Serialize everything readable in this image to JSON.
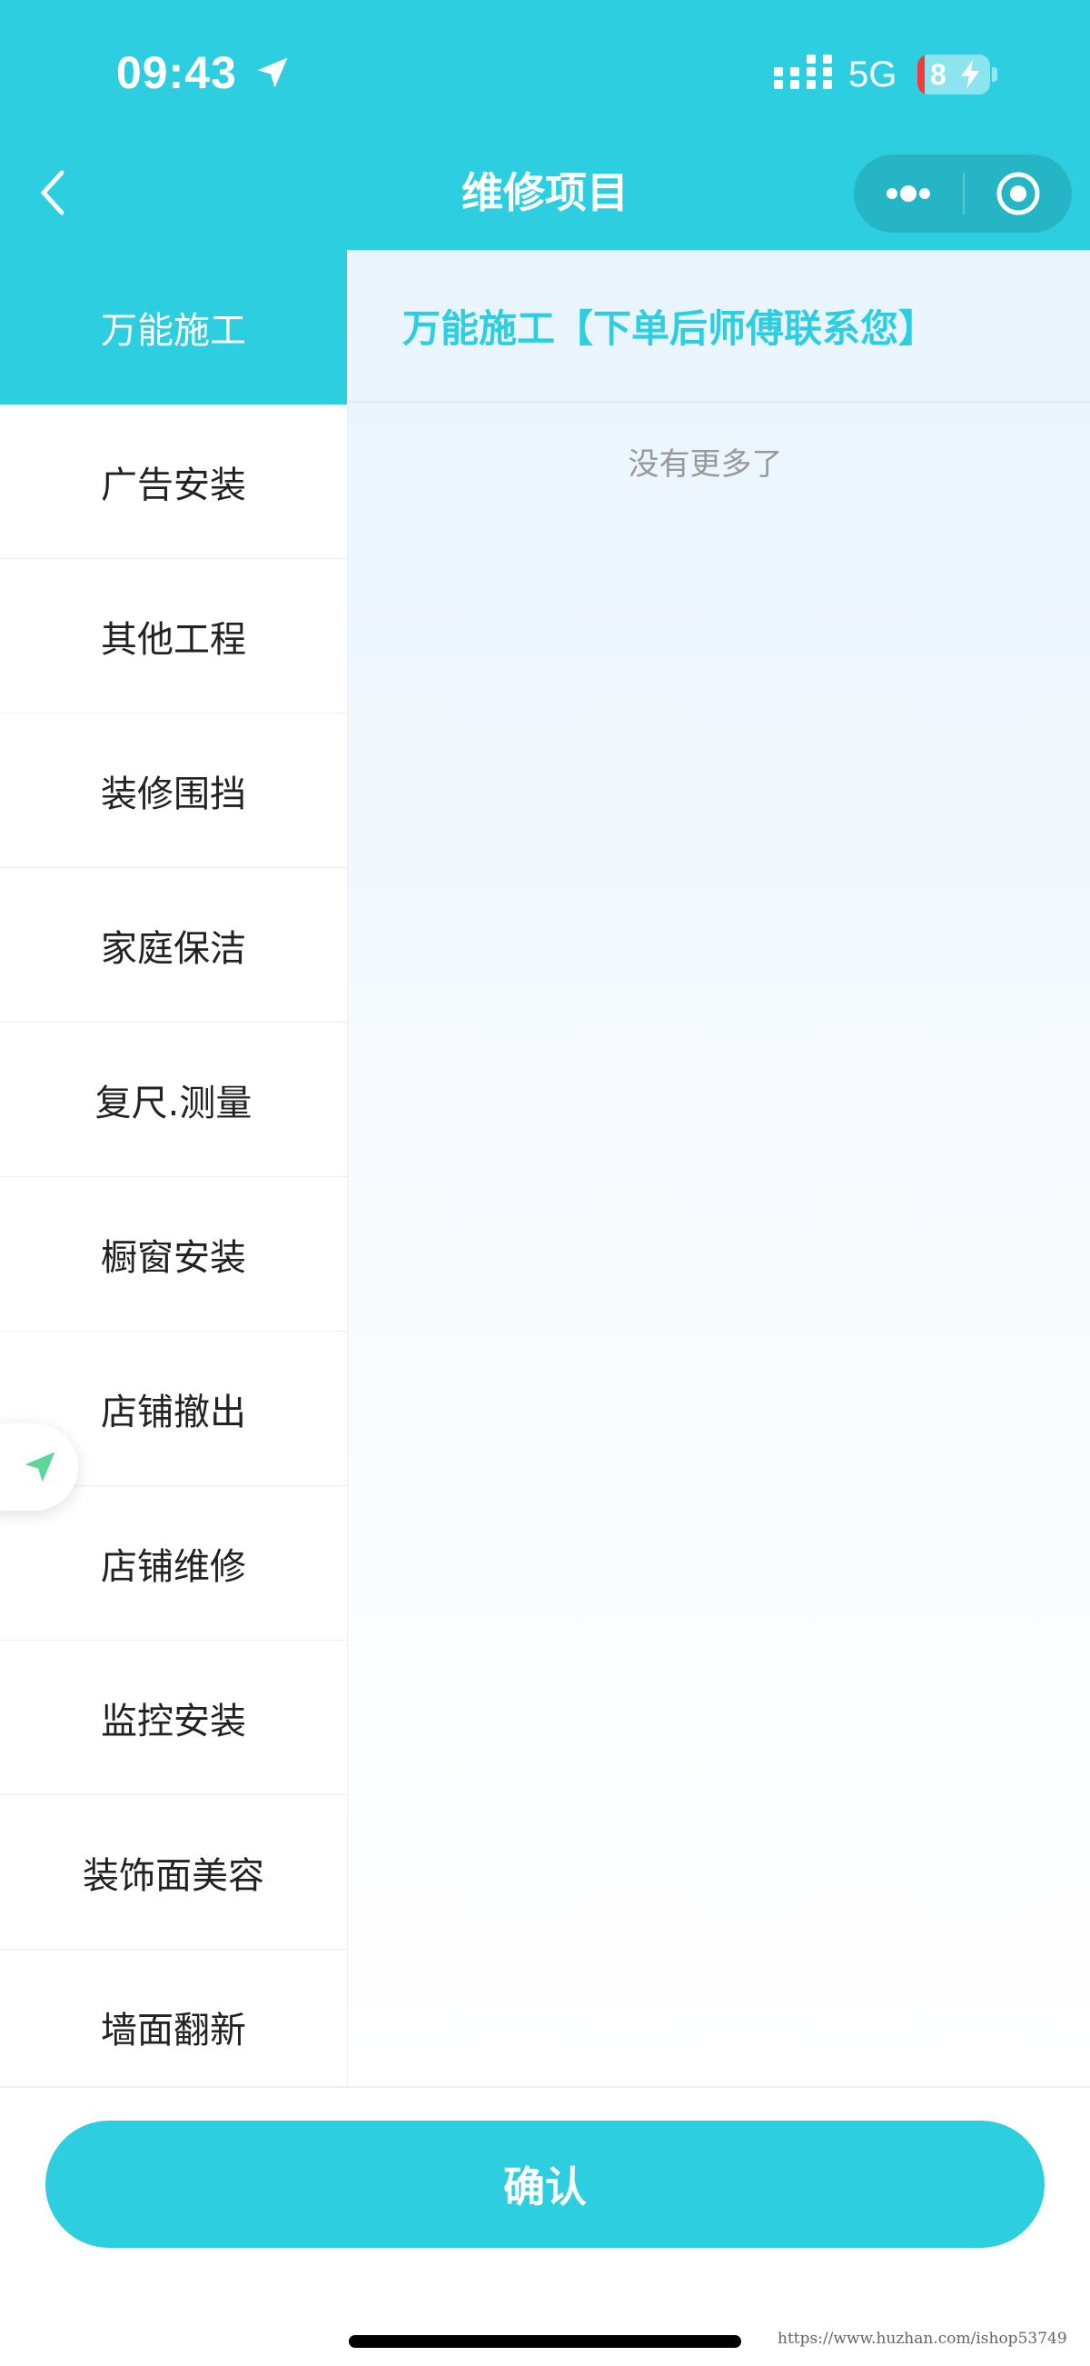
{
  "status_bar": {
    "time": "09:43",
    "network": "5G",
    "battery_level": "8",
    "battery_low_color": "#f03c3c"
  },
  "nav": {
    "title": "维修项目",
    "back_icon": "chevron-left-icon",
    "more_icon": "more-dots-icon",
    "close_icon": "miniprogram-close-icon"
  },
  "sidebar": {
    "items": [
      {
        "label": "万能施工",
        "active": true
      },
      {
        "label": "广告安装",
        "active": false
      },
      {
        "label": "其他工程",
        "active": false
      },
      {
        "label": "装修围挡",
        "active": false
      },
      {
        "label": "家庭保洁",
        "active": false
      },
      {
        "label": "复尺.测量",
        "active": false
      },
      {
        "label": "橱窗安装",
        "active": false
      },
      {
        "label": "店铺撤出",
        "active": false
      },
      {
        "label": "店铺维修",
        "active": false
      },
      {
        "label": "监控安装",
        "active": false
      },
      {
        "label": "装饰面美容",
        "active": false
      },
      {
        "label": "墙面翻新",
        "active": false
      }
    ]
  },
  "content": {
    "header": "万能施工【下单后师傅联系您】",
    "empty_text": "没有更多了"
  },
  "floating": {
    "icon": "location-arrow-icon"
  },
  "footer": {
    "confirm_label": "确认",
    "watermark": "https://www.huzhan.com/ishop53749"
  },
  "colors": {
    "primary": "#2ccee0",
    "text": "#222222",
    "muted": "#999999",
    "float_icon": "#5dd69b"
  }
}
